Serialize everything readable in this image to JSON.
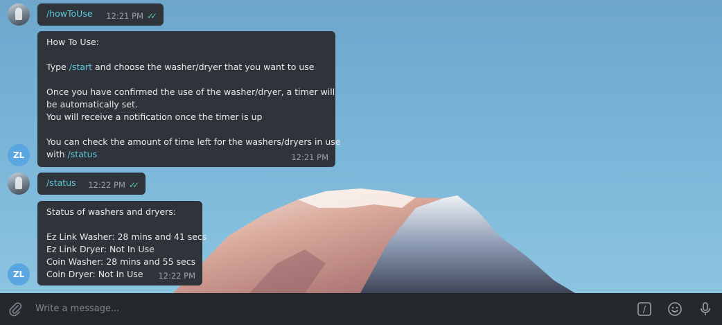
{
  "messages": [
    {
      "side": "outgoing",
      "text": "/howToUse",
      "time": "12:21 PM",
      "read_receipt": "double-check-icon"
    },
    {
      "side": "incoming",
      "sender_initials": "ZL",
      "lines": [
        "How To Use:",
        "",
        "Type ",
        "",
        "Once you have confirmed the use of the washer/dryer, a timer will",
        "be automatically set.",
        "You will receive a notification once the timer is up",
        "",
        "You can check the amount of time left for the washers/dryers in use",
        "with "
      ],
      "start_cmd": "/start",
      "start_suffix": " and choose the washer/dryer that you want to use",
      "status_cmd": "/status",
      "time": "12:21 PM"
    },
    {
      "side": "outgoing",
      "text": "/status",
      "time": "12:22 PM",
      "read_receipt": "double-check-icon"
    },
    {
      "side": "incoming",
      "sender_initials": "ZL",
      "lines": [
        "Status of washers and dryers:",
        "",
        "Ez Link Washer: 28 mins and 41 secs",
        "Ez Link Dryer: Not In Use",
        "Coin Washer: 28 mins and 55 secs",
        "Coin Dryer: Not In Use"
      ],
      "time": "12:22 PM"
    }
  ],
  "composer": {
    "placeholder": "Write a message...",
    "attach_icon": "paperclip-icon",
    "commands_icon": "slash-command-icon",
    "command_glyph": "/",
    "emoji_icon": "smiley-icon",
    "mic_icon": "microphone-icon"
  },
  "colors": {
    "bubble": "#2f343b",
    "command_link": "#5ec8dc",
    "check": "#5ec8a4",
    "composer_bg": "#25292e",
    "avatar_initials_bg": "#5aa6e0"
  }
}
